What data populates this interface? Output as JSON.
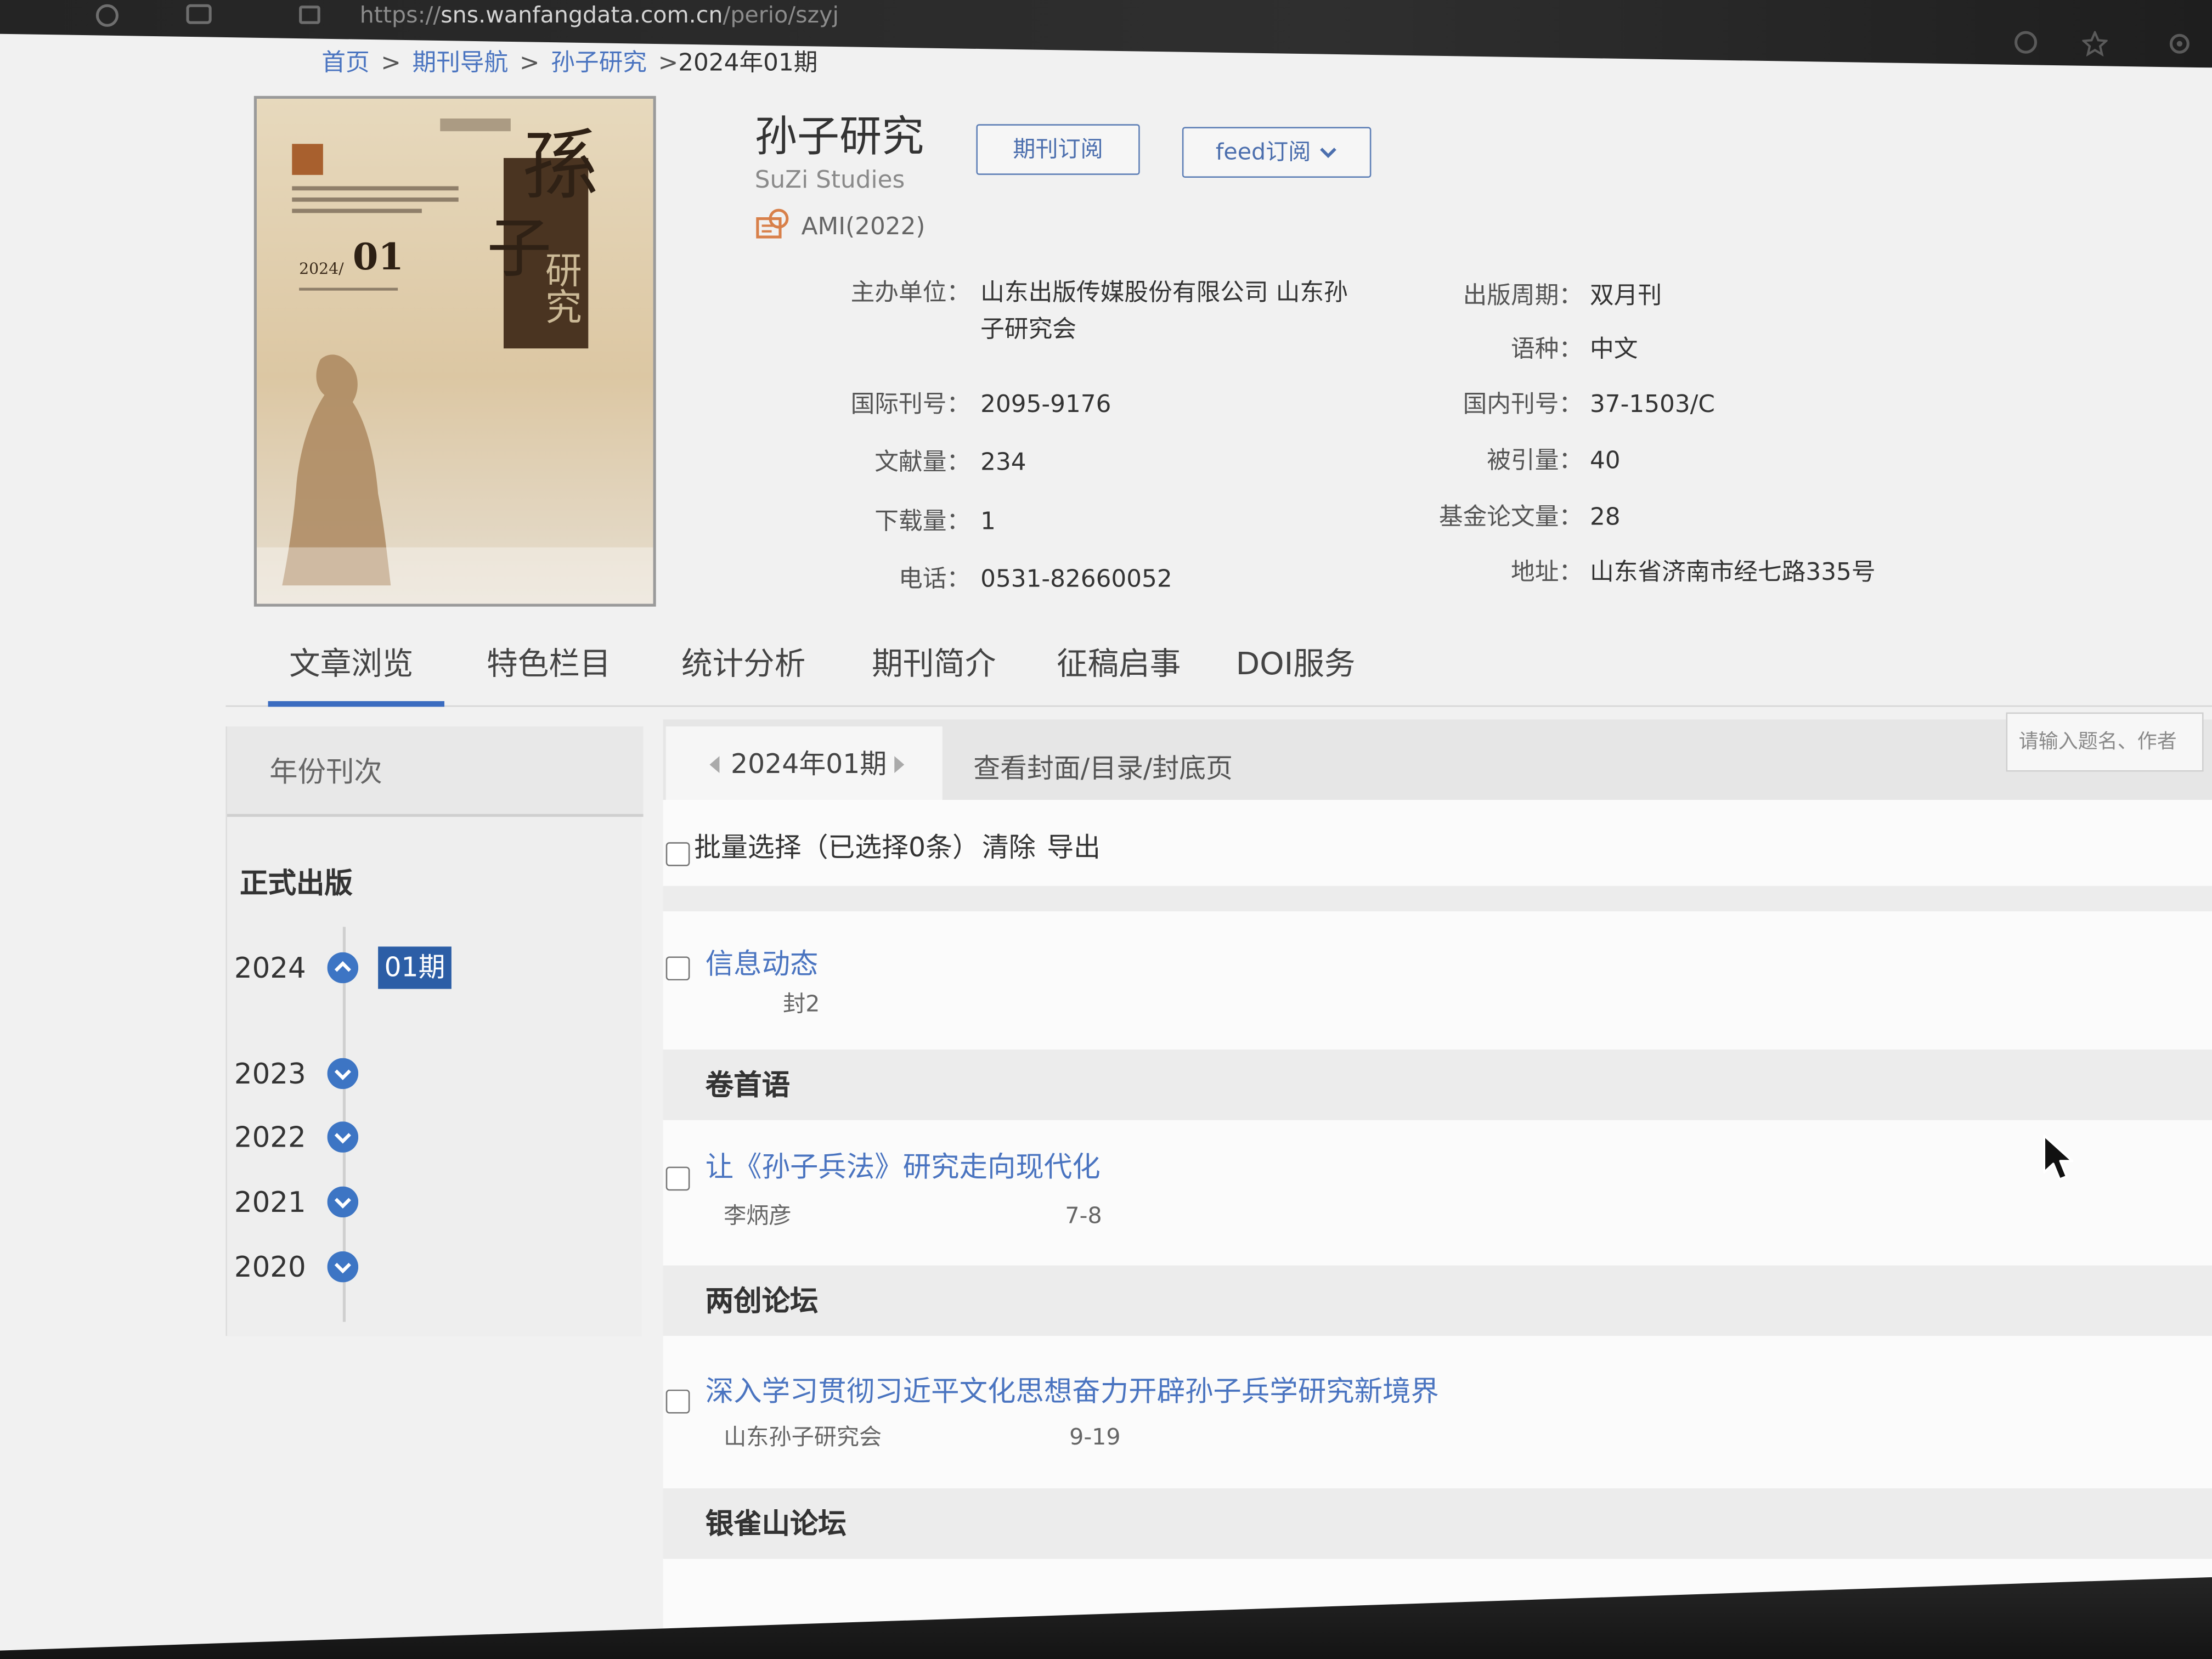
{
  "browser": {
    "url_scheme": "https://",
    "url_host": "sns.wanfangdata.com.cn",
    "url_path": "/perio/szyj"
  },
  "breadcrumb": {
    "separator": ">",
    "items": [
      "首页",
      "期刊导航",
      "孙子研究"
    ],
    "current": "2024年01期"
  },
  "cover": {
    "calligraphy_top": "孫",
    "calligraphy_mid": "子",
    "calligraphy_bar": "研究",
    "year": "2024/",
    "issue": "01"
  },
  "journal": {
    "title": "孙子研究",
    "english_title": "SuZi Studies",
    "ami": "AMI(2022)",
    "subscribe_label": "期刊订阅",
    "feed_label": "feed订阅"
  },
  "info": {
    "left": [
      {
        "label": "主办单位：",
        "value": "山东出版传媒股份有限公司 山东孙子研究会"
      },
      {
        "label": "国际刊号：",
        "value": "2095-9176"
      },
      {
        "label": "文献量：",
        "value": "234"
      },
      {
        "label": "下载量：",
        "value": "1"
      },
      {
        "label": "电话：",
        "value": "0531-82660052"
      }
    ],
    "right": [
      {
        "label": "出版周期：",
        "value": "双月刊"
      },
      {
        "label": "语种：",
        "value": "中文"
      },
      {
        "label": "国内刊号：",
        "value": "37-1503/C"
      },
      {
        "label": "被引量：",
        "value": "40"
      },
      {
        "label": "基金论文量：",
        "value": "28"
      },
      {
        "label": "地址：",
        "value": "山东省济南市经七路335号"
      }
    ]
  },
  "tabs": [
    {
      "label": "文章浏览",
      "active": true
    },
    {
      "label": "特色栏目",
      "active": false
    },
    {
      "label": "统计分析",
      "active": false
    },
    {
      "label": "期刊简介",
      "active": false
    },
    {
      "label": "征稿启事",
      "active": false
    },
    {
      "label": "DOI服务",
      "active": false
    }
  ],
  "sidebar": {
    "header": "年份刊次",
    "section_title": "正式出版",
    "years": [
      {
        "year": "2024",
        "expanded": true,
        "issues": [
          {
            "label": "01期",
            "selected": true
          }
        ]
      },
      {
        "year": "2023",
        "expanded": false
      },
      {
        "year": "2022",
        "expanded": false
      },
      {
        "year": "2021",
        "expanded": false
      },
      {
        "year": "2020",
        "expanded": false
      }
    ]
  },
  "issue_nav": {
    "current_issue": "2024年01期",
    "view_cover": "查看封面/目录/封底页"
  },
  "search": {
    "placeholder": "请输入题名、作者"
  },
  "batch": {
    "select_label": "批量选择（已选择0条）",
    "clear": "清除",
    "export": "导出"
  },
  "toc": {
    "untitled_items": [
      {
        "title": "信息动态",
        "pages": "封2"
      }
    ],
    "sections": [
      {
        "title": "卷首语",
        "articles": [
          {
            "title": "让《孙子兵法》研究走向现代化",
            "author": "李炳彦",
            "pages": "7-8"
          }
        ]
      },
      {
        "title": "两创论坛",
        "articles": [
          {
            "title": "深入学习贯彻习近平文化思想奋力开辟孙子兵学研究新境界",
            "author": "山东孙子研究会",
            "pages": "9-19"
          }
        ]
      },
      {
        "title": "银雀山论坛",
        "articles": []
      }
    ]
  },
  "icons": {
    "ami": "ami-icon",
    "feed_dropdown": "chevron-down-icon",
    "year_expanded": "chevron-up-icon",
    "year_collapsed": "chevron-down-icon",
    "pointer": "mouse-pointer-icon"
  },
  "colors": {
    "link": "#4a74c0",
    "accent": "#3b6cc0",
    "badge": "#2c5ea6",
    "chevron": "#3d75c4"
  }
}
